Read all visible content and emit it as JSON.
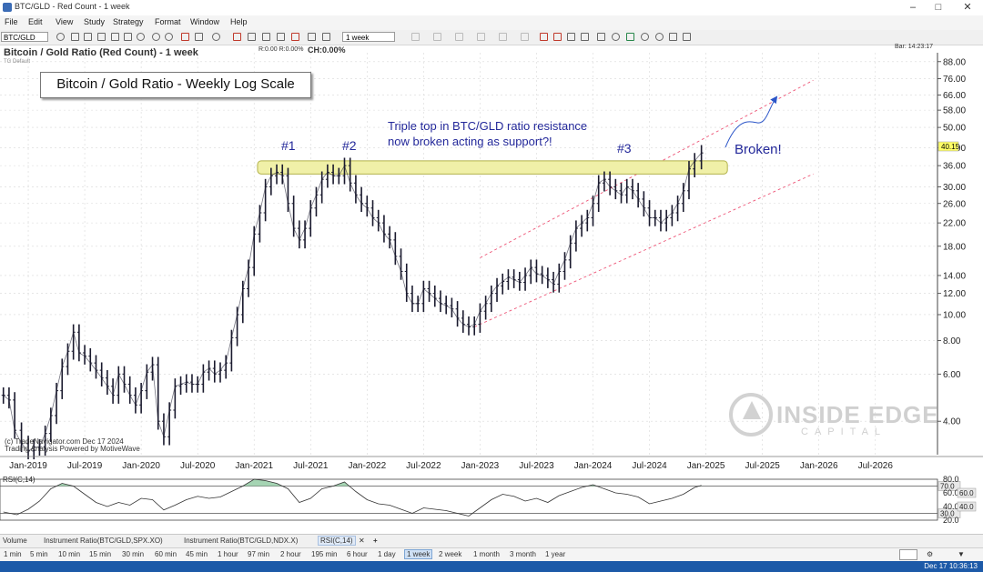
{
  "window": {
    "title": "BTC/GLD - Red Count - 1 week"
  },
  "menu": [
    "File",
    "Edit",
    "View",
    "Study",
    "Strategy",
    "Format",
    "Window",
    "Help"
  ],
  "toolbar": {
    "symbol": "BTC/GLD",
    "interval": "1 week"
  },
  "chart_header": {
    "title": "Bitcoin / Gold Ratio (Red Count) - 1 week",
    "subtitle": "TG Default",
    "ohlc": "R:0.00  R:0.00%",
    "change": "CH:0.00%",
    "bar_time": "Bar: 14:23:17"
  },
  "annotations": {
    "box_title": "Bitcoin / Gold Ratio - Weekly Log Scale",
    "triple_top_line1": "Triple top in BTC/GLD ratio resistance",
    "triple_top_line2": "now broken acting as support?!",
    "top1": "#1",
    "top2": "#2",
    "top3": "#3",
    "broken": "Broken!",
    "last_price": "40.15"
  },
  "watermark": {
    "line1": "INSIDE EDGE",
    "line2": "CAPITAL"
  },
  "copyright": {
    "line1": "(c) TradeNavigator.com Dec 17 2024",
    "line2": "Trading Analysis Powered by MotiveWave"
  },
  "colors": {
    "candle": "#1a1a2e",
    "resistance_band": "#f0f0a8",
    "channel": "#ee5577",
    "annotation_text": "#23289a",
    "rsi_fill": "#8ec9a0",
    "price_marker": "#ffff66"
  },
  "chart_data": [
    {
      "type": "line",
      "title": "Bitcoin / Gold Ratio (Red Count) - 1 week",
      "scale": "log",
      "ylim": [
        3,
        95
      ],
      "y_ticks": [
        4.0,
        6.0,
        8.0,
        10.0,
        12.0,
        14.0,
        18.0,
        22.0,
        26.0,
        30.0,
        36.0,
        42.0,
        50.0,
        58.0,
        66.0,
        76.0,
        88.0
      ],
      "x_ticks": [
        "Jan-2019",
        "Jul-2019",
        "Jan-2020",
        "Jul-2020",
        "Jan-2021",
        "Jul-2021",
        "Jan-2022",
        "Jul-2022",
        "Jan-2023",
        "Jul-2023",
        "Jan-2024",
        "Jul-2024",
        "Jan-2025",
        "Jul-2025",
        "Jan-2026",
        "Jul-2026"
      ],
      "x_tick_dates": [
        2019.0,
        2019.5,
        2020.0,
        2020.5,
        2021.0,
        2021.5,
        2022.0,
        2022.5,
        2023.0,
        2023.5,
        2024.0,
        2024.5,
        2025.0,
        2025.5,
        2026.0,
        2026.5
      ],
      "xlim": [
        2018.75,
        2027.05
      ],
      "grid": true,
      "series": [
        {
          "x": [
            2018.78,
            2018.83,
            2018.88,
            2018.94,
            2019.0,
            2019.05,
            2019.1,
            2019.15,
            2019.2,
            2019.25,
            2019.3,
            2019.35,
            2019.4,
            2019.45,
            2019.5,
            2019.55,
            2019.6,
            2019.65,
            2019.7,
            2019.75,
            2019.8,
            2019.85,
            2019.9,
            2019.95,
            2020.0,
            2020.05,
            2020.1,
            2020.15,
            2020.2,
            2020.25,
            2020.3,
            2020.35,
            2020.4,
            2020.45,
            2020.5,
            2020.55,
            2020.6,
            2020.65,
            2020.7,
            2020.75,
            2020.8,
            2020.85,
            2020.9,
            2020.95,
            2021.0,
            2021.05,
            2021.1,
            2021.15,
            2021.2,
            2021.25,
            2021.3,
            2021.35,
            2021.4,
            2021.45,
            2021.5,
            2021.55,
            2021.6,
            2021.65,
            2021.7,
            2021.75,
            2021.8,
            2021.85,
            2021.9,
            2021.95,
            2022.0,
            2022.05,
            2022.1,
            2022.15,
            2022.2,
            2022.25,
            2022.3,
            2022.35,
            2022.4,
            2022.45,
            2022.5,
            2022.55,
            2022.6,
            2022.65,
            2022.7,
            2022.75,
            2022.8,
            2022.85,
            2022.9,
            2022.95,
            2023.0,
            2023.05,
            2023.1,
            2023.15,
            2023.2,
            2023.25,
            2023.3,
            2023.35,
            2023.4,
            2023.45,
            2023.5,
            2023.55,
            2023.6,
            2023.65,
            2023.7,
            2023.75,
            2023.8,
            2023.85,
            2023.9,
            2023.95,
            2024.0,
            2024.05,
            2024.1,
            2024.15,
            2024.2,
            2024.25,
            2024.3,
            2024.35,
            2024.4,
            2024.45,
            2024.5,
            2024.55,
            2024.6,
            2024.65,
            2024.7,
            2024.75,
            2024.8,
            2024.85,
            2024.9,
            2024.96
          ],
          "y": [
            5.0,
            4.8,
            3.7,
            3.3,
            3.1,
            3.2,
            3.2,
            3.6,
            4.2,
            5.2,
            6.4,
            7.3,
            8.6,
            7.2,
            7.0,
            6.6,
            6.2,
            5.8,
            5.4,
            5.0,
            6.0,
            5.5,
            5.0,
            4.6,
            5.2,
            6.1,
            6.5,
            4.0,
            3.5,
            4.4,
            5.4,
            5.5,
            5.6,
            5.5,
            5.5,
            6.1,
            6.3,
            6.0,
            6.2,
            6.6,
            8.2,
            10.0,
            12.5,
            15.0,
            20.0,
            24.0,
            30.0,
            33.0,
            34.0,
            33.0,
            26.0,
            21.0,
            19.0,
            21.0,
            25.0,
            28.0,
            32.0,
            34.0,
            33.0,
            33.0,
            36.0,
            31.0,
            28.0,
            26.0,
            25.0,
            23.0,
            22.0,
            20.0,
            19.0,
            16.5,
            14.5,
            12.0,
            11.0,
            11.0,
            12.5,
            12.0,
            11.5,
            11.0,
            10.8,
            10.5,
            9.7,
            9.2,
            9.0,
            9.2,
            10.3,
            11.0,
            12.0,
            12.8,
            13.3,
            13.8,
            13.5,
            13.2,
            14.0,
            15.0,
            14.2,
            14.0,
            13.5,
            13.0,
            14.5,
            16.0,
            18.5,
            21.0,
            22.0,
            23.0,
            26.0,
            31.0,
            32.0,
            30.0,
            29.0,
            28.0,
            30.0,
            29.0,
            27.0,
            25.0,
            23.0,
            23.0,
            22.0,
            23.0,
            24.0,
            26.0,
            29.0,
            35.0,
            37.5,
            40.15
          ]
        }
      ]
    },
    {
      "type": "line",
      "title": "RSI(C,14)",
      "ylim": [
        20,
        80
      ],
      "y_ticks": [
        20.0,
        40.0,
        60.0,
        80.0
      ],
      "levels": [
        30,
        70
      ],
      "level_labels": [
        "30.0",
        "70.0"
      ],
      "markers": [
        "60.0",
        "40.0"
      ],
      "xlim": [
        2018.75,
        2027.05
      ],
      "series": [
        {
          "x": [
            2018.78,
            2018.9,
            2019.0,
            2019.1,
            2019.2,
            2019.3,
            2019.4,
            2019.5,
            2019.6,
            2019.7,
            2019.8,
            2019.9,
            2020.0,
            2020.1,
            2020.2,
            2020.3,
            2020.4,
            2020.5,
            2020.6,
            2020.7,
            2020.8,
            2020.9,
            2021.0,
            2021.1,
            2021.2,
            2021.3,
            2021.4,
            2021.5,
            2021.6,
            2021.7,
            2021.8,
            2021.9,
            2022.0,
            2022.1,
            2022.2,
            2022.3,
            2022.4,
            2022.5,
            2022.6,
            2022.7,
            2022.8,
            2022.9,
            2023.0,
            2023.1,
            2023.2,
            2023.3,
            2023.4,
            2023.5,
            2023.6,
            2023.7,
            2023.8,
            2023.9,
            2024.0,
            2024.1,
            2024.2,
            2024.3,
            2024.4,
            2024.5,
            2024.6,
            2024.7,
            2024.8,
            2024.9,
            2024.96
          ],
          "y": [
            32,
            28,
            36,
            48,
            66,
            74,
            70,
            58,
            46,
            40,
            46,
            42,
            52,
            50,
            35,
            42,
            50,
            55,
            52,
            54,
            62,
            70,
            80,
            78,
            74,
            66,
            46,
            52,
            66,
            70,
            76,
            62,
            50,
            44,
            42,
            36,
            30,
            38,
            36,
            34,
            30,
            26,
            38,
            50,
            58,
            55,
            48,
            52,
            46,
            56,
            62,
            68,
            72,
            66,
            60,
            58,
            54,
            44,
            48,
            52,
            58,
            68,
            71
          ]
        }
      ]
    }
  ],
  "bottom_tabs": [
    "Volume",
    "Instrument Ratio(BTC/GLD,SPX.XO)",
    "Instrument Ratio(BTC/GLD,NDX.X)",
    "RSI(C,14)"
  ],
  "timeframes": [
    "1 min",
    "5 min",
    "10 min",
    "15 min",
    "30 min",
    "60 min",
    "45 min",
    "1 hour",
    "97 min",
    "2 hour",
    "195 min",
    "6 hour",
    "1 day",
    "1 week",
    "2 week",
    "1 month",
    "3 month",
    "1 year"
  ],
  "timeframe_selected": "1 week",
  "status": {
    "datetime": "Dec 17 10:36:13"
  }
}
